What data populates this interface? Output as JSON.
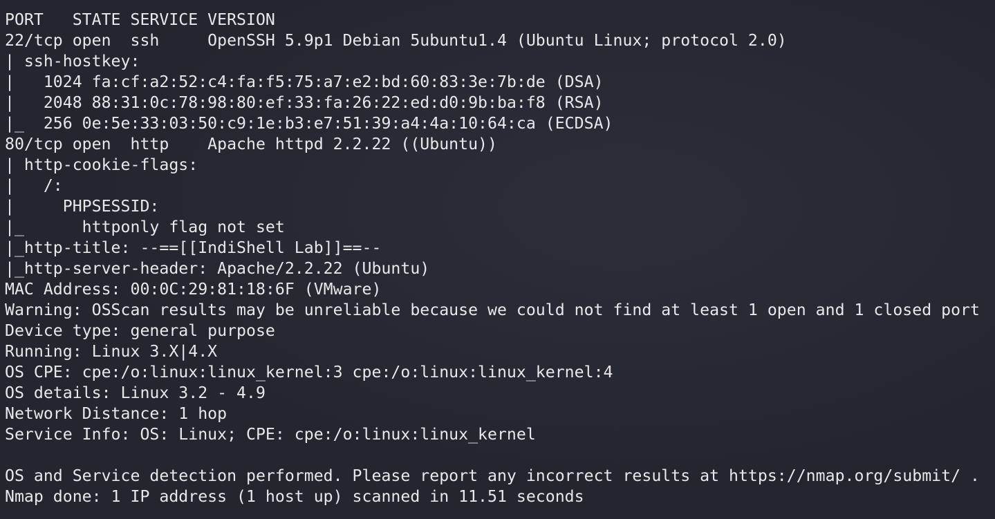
{
  "terminal": {
    "lines": [
      "PORT   STATE SERVICE VERSION",
      "22/tcp open  ssh     OpenSSH 5.9p1 Debian 5ubuntu1.4 (Ubuntu Linux; protocol 2.0)",
      "| ssh-hostkey: ",
      "|   1024 fa:cf:a2:52:c4:fa:f5:75:a7:e2:bd:60:83:3e:7b:de (DSA)",
      "|   2048 88:31:0c:78:98:80:ef:33:fa:26:22:ed:d0:9b:ba:f8 (RSA)",
      "|_  256 0e:5e:33:03:50:c9:1e:b3:e7:51:39:a4:4a:10:64:ca (ECDSA)",
      "80/tcp open  http    Apache httpd 2.2.22 ((Ubuntu))",
      "| http-cookie-flags: ",
      "|   /: ",
      "|     PHPSESSID: ",
      "|_      httponly flag not set",
      "|_http-title: --==[[IndiShell Lab]]==--",
      "|_http-server-header: Apache/2.2.22 (Ubuntu)",
      "MAC Address: 00:0C:29:81:18:6F (VMware)",
      "Warning: OSScan results may be unreliable because we could not find at least 1 open and 1 closed port",
      "Device type: general purpose",
      "Running: Linux 3.X|4.X",
      "OS CPE: cpe:/o:linux:linux_kernel:3 cpe:/o:linux:linux_kernel:4",
      "OS details: Linux 3.2 - 4.9",
      "Network Distance: 1 hop",
      "Service Info: OS: Linux; CPE: cpe:/o:linux:linux_kernel",
      "",
      "OS and Service detection performed. Please report any incorrect results at https://nmap.org/submit/ .",
      "Nmap done: 1 IP address (1 host up) scanned in 11.51 seconds"
    ]
  }
}
